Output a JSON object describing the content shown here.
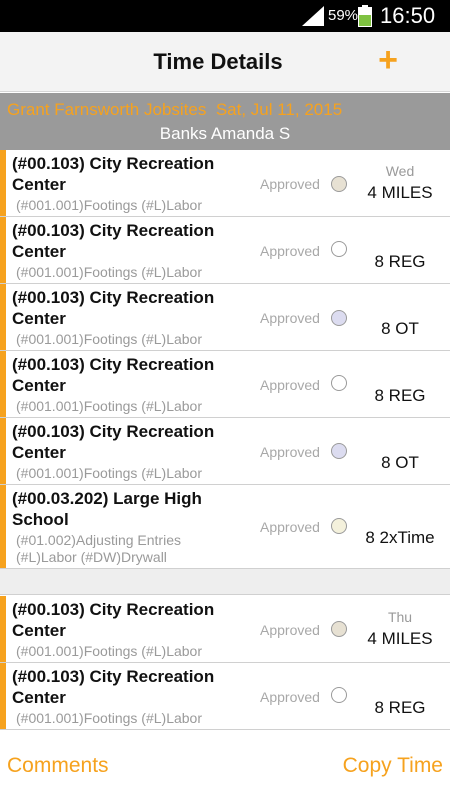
{
  "status_bar": {
    "battery_percent": "59%",
    "time": "16:50",
    "signal_icon": "signal-icon",
    "battery_icon": "battery-icon"
  },
  "header": {
    "title": "Time Details",
    "add_icon": "plus-icon",
    "add_label": "+"
  },
  "subheader": {
    "company": "Grant Farnsworth Jobsites",
    "date": "Sat, Jul 11, 2015",
    "employee": "Banks Amanda S"
  },
  "entries": [
    {
      "job": "(#00.103) City Recreation Center",
      "detail": "(#001.001)Footings (#L)Labor",
      "status": "Approved",
      "day": "Wed",
      "hours": "4 MILES",
      "radio_fill": "#e7e1d3"
    },
    {
      "job": "(#00.103) City Recreation Center",
      "detail": "(#001.001)Footings (#L)Labor",
      "status": "Approved",
      "day": "",
      "hours": "8 REG",
      "radio_fill": "#ffffff"
    },
    {
      "job": "(#00.103) City Recreation Center",
      "detail": "(#001.001)Footings (#L)Labor",
      "status": "Approved",
      "day": "",
      "hours": "8 OT",
      "radio_fill": "#dcdcf0"
    },
    {
      "job": "(#00.103) City Recreation Center",
      "detail": "(#001.001)Footings (#L)Labor",
      "status": "Approved",
      "day": "",
      "hours": "8 REG",
      "radio_fill": "#ffffff"
    },
    {
      "job": "(#00.103) City Recreation Center",
      "detail": "(#001.001)Footings (#L)Labor",
      "status": "Approved",
      "day": "",
      "hours": "8 OT",
      "radio_fill": "#dcdcf0"
    },
    {
      "job": "(#00.03.202) Large High School",
      "detail": "(#01.002)Adjusting Entries (#L)Labor (#DW)Drywall",
      "status": "Approved",
      "day": "",
      "hours": "8 2xTime",
      "radio_fill": "#f4f1dc"
    },
    {
      "job": "(#00.103) City Recreation Center",
      "detail": "(#001.001)Footings (#L)Labor",
      "status": "Approved",
      "day": "Thu",
      "hours": "4 MILES",
      "radio_fill": "#e7e1d3"
    },
    {
      "job": "(#00.103) City Recreation Center",
      "detail": "(#001.001)Footings (#L)Labor",
      "status": "Approved",
      "day": "",
      "hours": "8 REG",
      "radio_fill": "#ffffff"
    }
  ],
  "footer": {
    "comments_label": "Comments",
    "copy_time_label": "Copy Time"
  },
  "colors": {
    "accent": "#f6a21e",
    "subheader_bg": "#9a9a9a"
  }
}
